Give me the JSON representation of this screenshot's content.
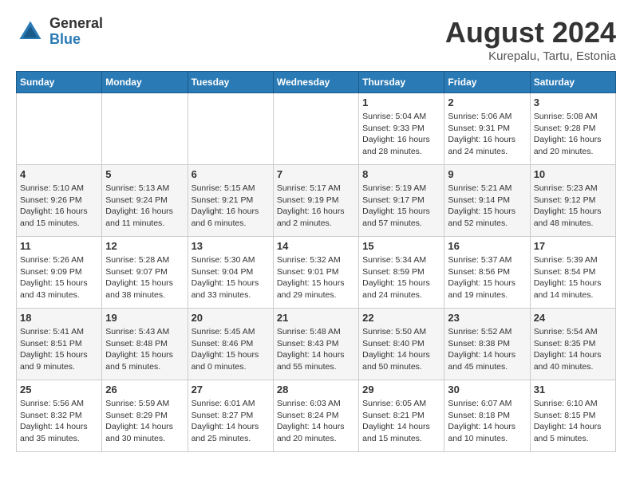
{
  "header": {
    "logo_line1": "General",
    "logo_line2": "Blue",
    "month_year": "August 2024",
    "location": "Kurepalu, Tartu, Estonia"
  },
  "weekdays": [
    "Sunday",
    "Monday",
    "Tuesday",
    "Wednesday",
    "Thursday",
    "Friday",
    "Saturday"
  ],
  "weeks": [
    [
      {
        "day": "",
        "content": ""
      },
      {
        "day": "",
        "content": ""
      },
      {
        "day": "",
        "content": ""
      },
      {
        "day": "",
        "content": ""
      },
      {
        "day": "1",
        "content": "Sunrise: 5:04 AM\nSunset: 9:33 PM\nDaylight: 16 hours\nand 28 minutes."
      },
      {
        "day": "2",
        "content": "Sunrise: 5:06 AM\nSunset: 9:31 PM\nDaylight: 16 hours\nand 24 minutes."
      },
      {
        "day": "3",
        "content": "Sunrise: 5:08 AM\nSunset: 9:28 PM\nDaylight: 16 hours\nand 20 minutes."
      }
    ],
    [
      {
        "day": "4",
        "content": "Sunrise: 5:10 AM\nSunset: 9:26 PM\nDaylight: 16 hours\nand 15 minutes."
      },
      {
        "day": "5",
        "content": "Sunrise: 5:13 AM\nSunset: 9:24 PM\nDaylight: 16 hours\nand 11 minutes."
      },
      {
        "day": "6",
        "content": "Sunrise: 5:15 AM\nSunset: 9:21 PM\nDaylight: 16 hours\nand 6 minutes."
      },
      {
        "day": "7",
        "content": "Sunrise: 5:17 AM\nSunset: 9:19 PM\nDaylight: 16 hours\nand 2 minutes."
      },
      {
        "day": "8",
        "content": "Sunrise: 5:19 AM\nSunset: 9:17 PM\nDaylight: 15 hours\nand 57 minutes."
      },
      {
        "day": "9",
        "content": "Sunrise: 5:21 AM\nSunset: 9:14 PM\nDaylight: 15 hours\nand 52 minutes."
      },
      {
        "day": "10",
        "content": "Sunrise: 5:23 AM\nSunset: 9:12 PM\nDaylight: 15 hours\nand 48 minutes."
      }
    ],
    [
      {
        "day": "11",
        "content": "Sunrise: 5:26 AM\nSunset: 9:09 PM\nDaylight: 15 hours\nand 43 minutes."
      },
      {
        "day": "12",
        "content": "Sunrise: 5:28 AM\nSunset: 9:07 PM\nDaylight: 15 hours\nand 38 minutes."
      },
      {
        "day": "13",
        "content": "Sunrise: 5:30 AM\nSunset: 9:04 PM\nDaylight: 15 hours\nand 33 minutes."
      },
      {
        "day": "14",
        "content": "Sunrise: 5:32 AM\nSunset: 9:01 PM\nDaylight: 15 hours\nand 29 minutes."
      },
      {
        "day": "15",
        "content": "Sunrise: 5:34 AM\nSunset: 8:59 PM\nDaylight: 15 hours\nand 24 minutes."
      },
      {
        "day": "16",
        "content": "Sunrise: 5:37 AM\nSunset: 8:56 PM\nDaylight: 15 hours\nand 19 minutes."
      },
      {
        "day": "17",
        "content": "Sunrise: 5:39 AM\nSunset: 8:54 PM\nDaylight: 15 hours\nand 14 minutes."
      }
    ],
    [
      {
        "day": "18",
        "content": "Sunrise: 5:41 AM\nSunset: 8:51 PM\nDaylight: 15 hours\nand 9 minutes."
      },
      {
        "day": "19",
        "content": "Sunrise: 5:43 AM\nSunset: 8:48 PM\nDaylight: 15 hours\nand 5 minutes."
      },
      {
        "day": "20",
        "content": "Sunrise: 5:45 AM\nSunset: 8:46 PM\nDaylight: 15 hours\nand 0 minutes."
      },
      {
        "day": "21",
        "content": "Sunrise: 5:48 AM\nSunset: 8:43 PM\nDaylight: 14 hours\nand 55 minutes."
      },
      {
        "day": "22",
        "content": "Sunrise: 5:50 AM\nSunset: 8:40 PM\nDaylight: 14 hours\nand 50 minutes."
      },
      {
        "day": "23",
        "content": "Sunrise: 5:52 AM\nSunset: 8:38 PM\nDaylight: 14 hours\nand 45 minutes."
      },
      {
        "day": "24",
        "content": "Sunrise: 5:54 AM\nSunset: 8:35 PM\nDaylight: 14 hours\nand 40 minutes."
      }
    ],
    [
      {
        "day": "25",
        "content": "Sunrise: 5:56 AM\nSunset: 8:32 PM\nDaylight: 14 hours\nand 35 minutes."
      },
      {
        "day": "26",
        "content": "Sunrise: 5:59 AM\nSunset: 8:29 PM\nDaylight: 14 hours\nand 30 minutes."
      },
      {
        "day": "27",
        "content": "Sunrise: 6:01 AM\nSunset: 8:27 PM\nDaylight: 14 hours\nand 25 minutes."
      },
      {
        "day": "28",
        "content": "Sunrise: 6:03 AM\nSunset: 8:24 PM\nDaylight: 14 hours\nand 20 minutes."
      },
      {
        "day": "29",
        "content": "Sunrise: 6:05 AM\nSunset: 8:21 PM\nDaylight: 14 hours\nand 15 minutes."
      },
      {
        "day": "30",
        "content": "Sunrise: 6:07 AM\nSunset: 8:18 PM\nDaylight: 14 hours\nand 10 minutes."
      },
      {
        "day": "31",
        "content": "Sunrise: 6:10 AM\nSunset: 8:15 PM\nDaylight: 14 hours\nand 5 minutes."
      }
    ]
  ]
}
